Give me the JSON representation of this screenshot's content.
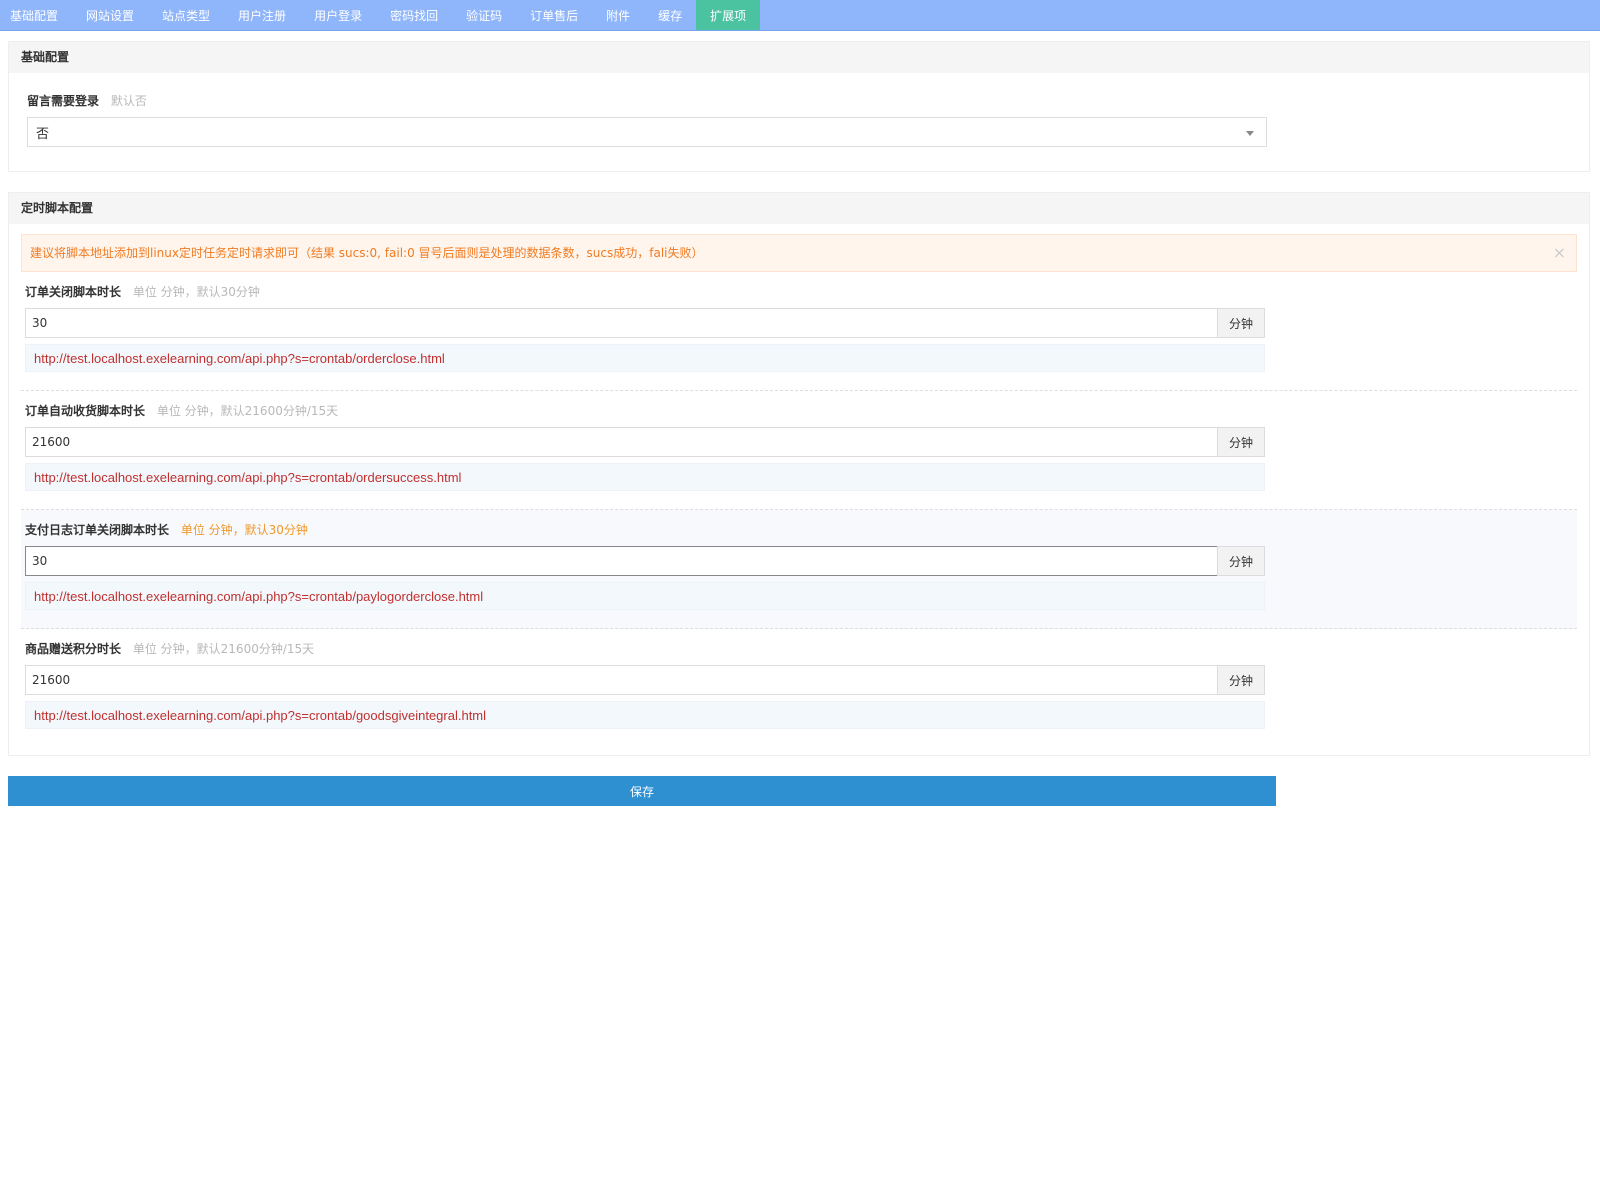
{
  "tabs": [
    {
      "label": "基础配置",
      "active": false
    },
    {
      "label": "网站设置",
      "active": false
    },
    {
      "label": "站点类型",
      "active": false
    },
    {
      "label": "用户注册",
      "active": false
    },
    {
      "label": "用户登录",
      "active": false
    },
    {
      "label": "密码找回",
      "active": false
    },
    {
      "label": "验证码",
      "active": false
    },
    {
      "label": "订单售后",
      "active": false
    },
    {
      "label": "附件",
      "active": false
    },
    {
      "label": "缓存",
      "active": false
    },
    {
      "label": "扩展项",
      "active": true
    }
  ],
  "basic": {
    "title": "基础配置",
    "comment_login": {
      "label": "留言需要登录",
      "tip": "默认否",
      "value": "否"
    }
  },
  "cron": {
    "title": "定时脚本配置",
    "alert": "建议将脚本地址添加到linux定时任务定时请求即可（结果 sucs:0, fail:0 冒号后面则是处理的数据条数，sucs成功，fali失败）",
    "close_symbol": "×",
    "fields": [
      {
        "label": "订单关闭脚本时长",
        "tip": "单位 分钟，默认30分钟",
        "value": "30",
        "unit": "分钟",
        "url": "http://test.localhost.exelearning.com/api.php?s=crontab/orderclose.html"
      },
      {
        "label": "订单自动收货脚本时长",
        "tip": "单位 分钟，默认21600分钟/15天",
        "value": "21600",
        "unit": "分钟",
        "url": "http://test.localhost.exelearning.com/api.php?s=crontab/ordersuccess.html"
      },
      {
        "label": "支付日志订单关闭脚本时长",
        "tip": "单位 分钟，默认30分钟",
        "value": "30",
        "unit": "分钟",
        "url": "http://test.localhost.exelearning.com/api.php?s=crontab/paylogorderclose.html"
      },
      {
        "label": "商品赠送积分时长",
        "tip": "单位 分钟，默认21600分钟/15天",
        "value": "21600",
        "unit": "分钟",
        "url": "http://test.localhost.exelearning.com/api.php?s=crontab/goodsgiveintegral.html"
      }
    ]
  },
  "save_label": "保存",
  "colors": {
    "topbar": "#8fb5fb",
    "active_tab": "#4cc3a0",
    "save_button": "#2e8fd1",
    "url_text": "#c0302e",
    "alert_text": "#f07b22"
  }
}
